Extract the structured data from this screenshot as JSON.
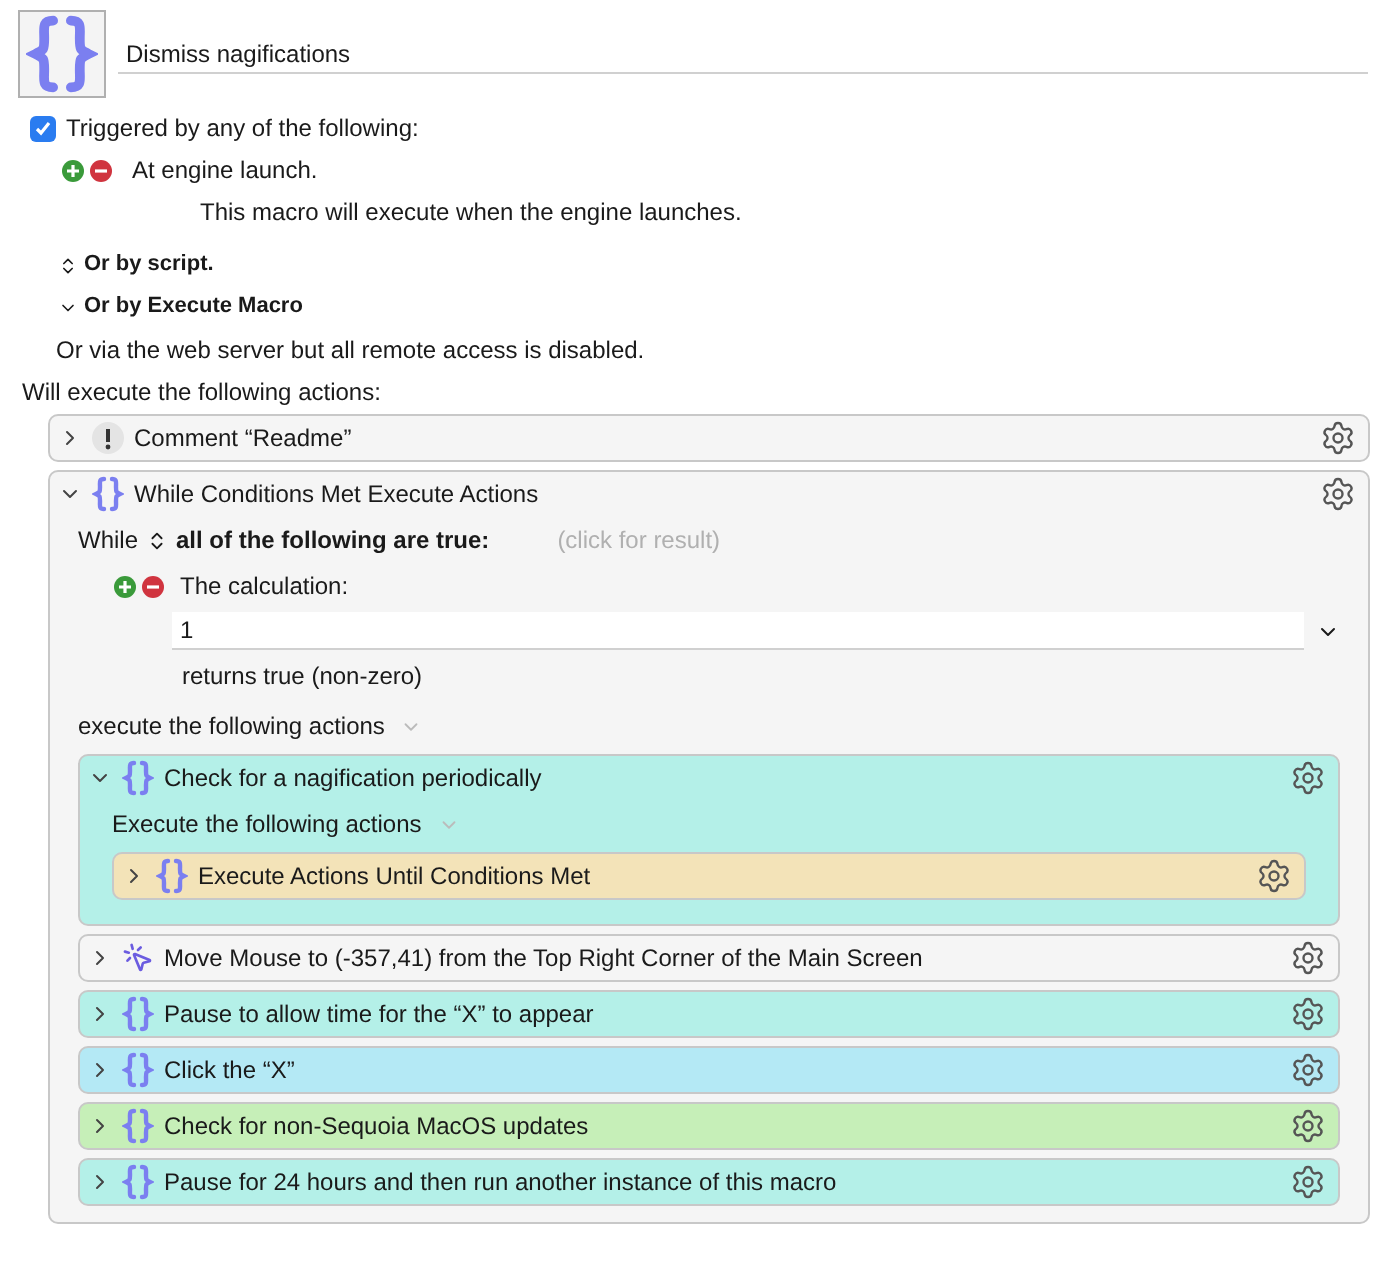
{
  "macro": {
    "name": "Dismiss nagifications"
  },
  "trigger": {
    "label": "Triggered by any of the following:",
    "checked": true,
    "items": [
      {
        "label": "At engine launch.",
        "description": "This macro will execute when the engine launches."
      }
    ],
    "options": [
      {
        "label": "Or by script.",
        "kind": "updown"
      },
      {
        "label": "Or by Execute Macro",
        "kind": "down"
      }
    ],
    "web": "Or via the web server but all remote access is disabled."
  },
  "actions_label": "Will execute the following actions:",
  "actions": [
    {
      "kind": "comment",
      "title": "Comment “Readme”",
      "expanded": false,
      "color": "#f5f5f5"
    },
    {
      "kind": "while",
      "title": "While Conditions Met Execute Actions",
      "expanded": true,
      "color": "#f5f5f5",
      "while_label": "While",
      "condition_mode": "all of the following are true:",
      "result_hint": "(click for result)",
      "conditions": [
        {
          "label": "The calculation:",
          "value": "1",
          "returns": "returns true (non-zero)"
        }
      ],
      "execute_label": "execute the following actions",
      "children": [
        {
          "kind": "group",
          "title": "Check for a nagification periodically",
          "expanded": true,
          "color": "#b4f0e8",
          "execute_label": "Execute the following actions",
          "children": [
            {
              "kind": "group",
              "title": "Execute Actions Until Conditions Met",
              "expanded": false,
              "color": "#f3e3b8"
            }
          ]
        },
        {
          "kind": "mouse",
          "title": "Move Mouse to (-357,41) from the Top Right Corner of the Main Screen",
          "expanded": false,
          "color": "#f5f5f5"
        },
        {
          "kind": "group",
          "title": "Pause to allow time for the “X” to appear",
          "expanded": false,
          "color": "#b4f0e8"
        },
        {
          "kind": "group",
          "title": "Click the “X”",
          "expanded": false,
          "color": "#b4e9f5"
        },
        {
          "kind": "group",
          "title": "Check for non-Sequoia MacOS updates",
          "expanded": false,
          "color": "#c6efb8"
        },
        {
          "kind": "group",
          "title": "Pause for 24 hours and then run another instance of this macro",
          "expanded": false,
          "color": "#b4f0e8"
        }
      ]
    }
  ]
}
